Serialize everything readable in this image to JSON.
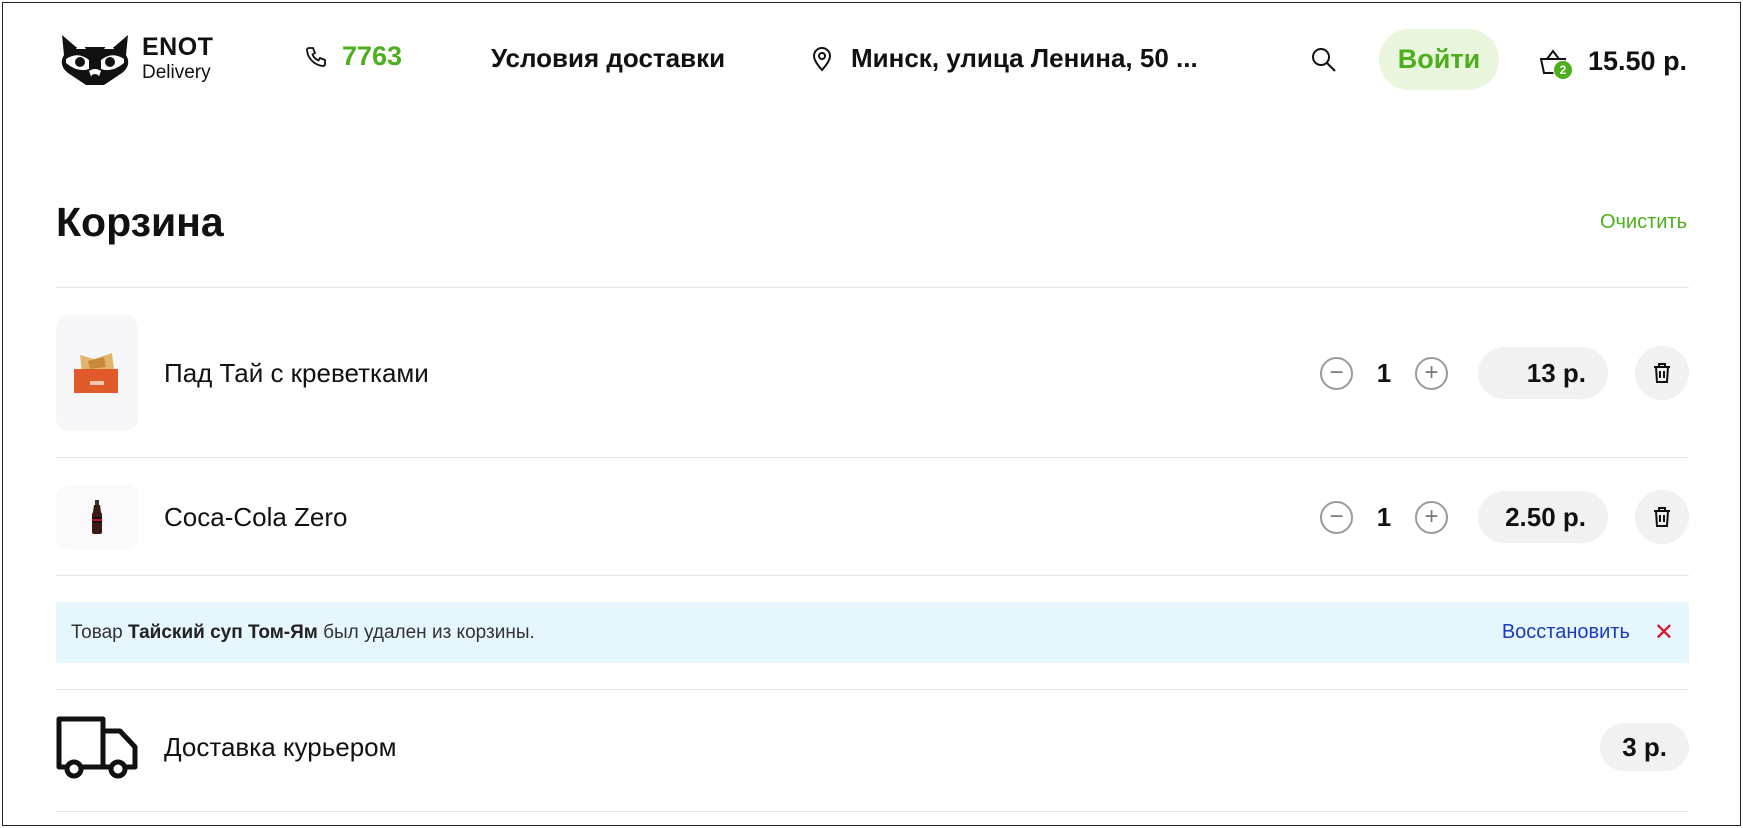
{
  "header": {
    "logo_name": "ENOT",
    "logo_sub": "Delivery",
    "phone": "7763",
    "delivery_terms": "Условия доставки",
    "address": "Минск, улица Ленина, 50 ...",
    "login": "Войти",
    "cart_count": "2",
    "cart_total": "15.50 р."
  },
  "page": {
    "title": "Корзина",
    "clear_label": "Очистить"
  },
  "cart": {
    "items": [
      {
        "name": "Пад Тай с креветками",
        "qty": "1",
        "price": "13 р.",
        "decrement": "−",
        "increment": "+"
      },
      {
        "name": "Coca-Cola Zero",
        "qty": "1",
        "price": "2.50 р.",
        "decrement": "−",
        "increment": "+"
      }
    ]
  },
  "notice": {
    "prefix": "Товар ",
    "product": "Тайский суп Том-Ям",
    "suffix": " был удален из корзины.",
    "restore": "Восстановить",
    "close": "✕"
  },
  "delivery": {
    "label": "Доставка курьером",
    "price": "3 р."
  },
  "colors": {
    "accent": "#4caf1b",
    "accent_light": "#e9f5dc",
    "notice_bg": "#e6f6fd",
    "restore_link": "#1a3bbf",
    "close": "#d71a2a"
  },
  "icons": [
    "raccoon-logo-icon",
    "phone-icon",
    "location-pin-icon",
    "search-icon",
    "basket-icon",
    "trash-icon",
    "truck-icon"
  ]
}
